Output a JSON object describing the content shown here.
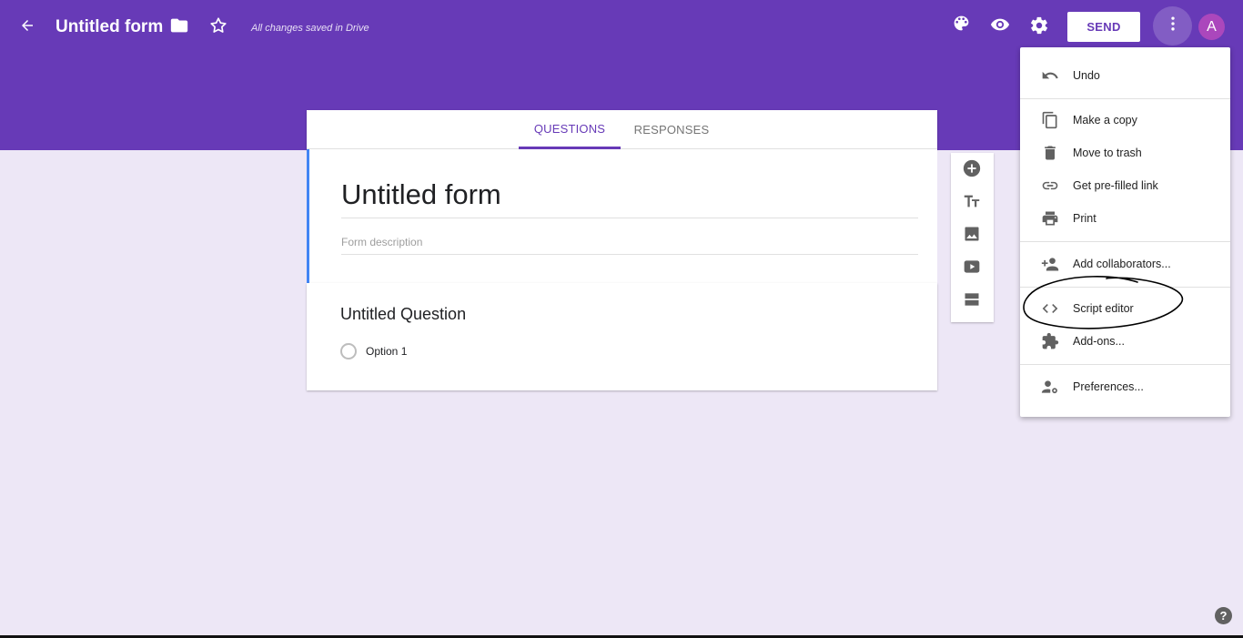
{
  "topbar": {
    "form_title": "Untitled form",
    "saved_status": "All changes saved in Drive",
    "send_label": "SEND",
    "avatar_letter": "A",
    "icons": [
      "back-arrow-icon",
      "folder-icon",
      "star-icon",
      "palette-icon",
      "eye-icon",
      "gear-icon",
      "more-vert-icon"
    ]
  },
  "tabs": [
    {
      "label": "QUESTIONS",
      "active": true
    },
    {
      "label": "RESPONSES",
      "active": false
    }
  ],
  "form": {
    "title": "Untitled form",
    "description_placeholder": "Form description",
    "question": {
      "title": "Untitled Question",
      "options": [
        "Option 1"
      ]
    }
  },
  "side_toolbar": [
    "add-question-icon",
    "title-text-icon",
    "image-icon",
    "video-icon",
    "section-icon"
  ],
  "menu": {
    "items": [
      {
        "label": "Undo",
        "icon": "undo-icon"
      },
      {
        "label": "Make a copy",
        "icon": "copy-icon"
      },
      {
        "label": "Move to trash",
        "icon": "trash-icon"
      },
      {
        "label": "Get pre-filled link",
        "icon": "link-icon"
      },
      {
        "label": "Print",
        "icon": "print-icon"
      },
      {
        "label": "Add collaborators...",
        "icon": "add-collaborator-icon"
      },
      {
        "label": "Script editor",
        "icon": "code-icon"
      },
      {
        "label": "Add-ons...",
        "icon": "puzzle-icon"
      },
      {
        "label": "Preferences...",
        "icon": "preferences-icon"
      }
    ]
  },
  "help_glyph": "?",
  "colors": {
    "brand": "#673ab7",
    "page_background": "#ede7f6",
    "menu_icon": "#616161"
  }
}
